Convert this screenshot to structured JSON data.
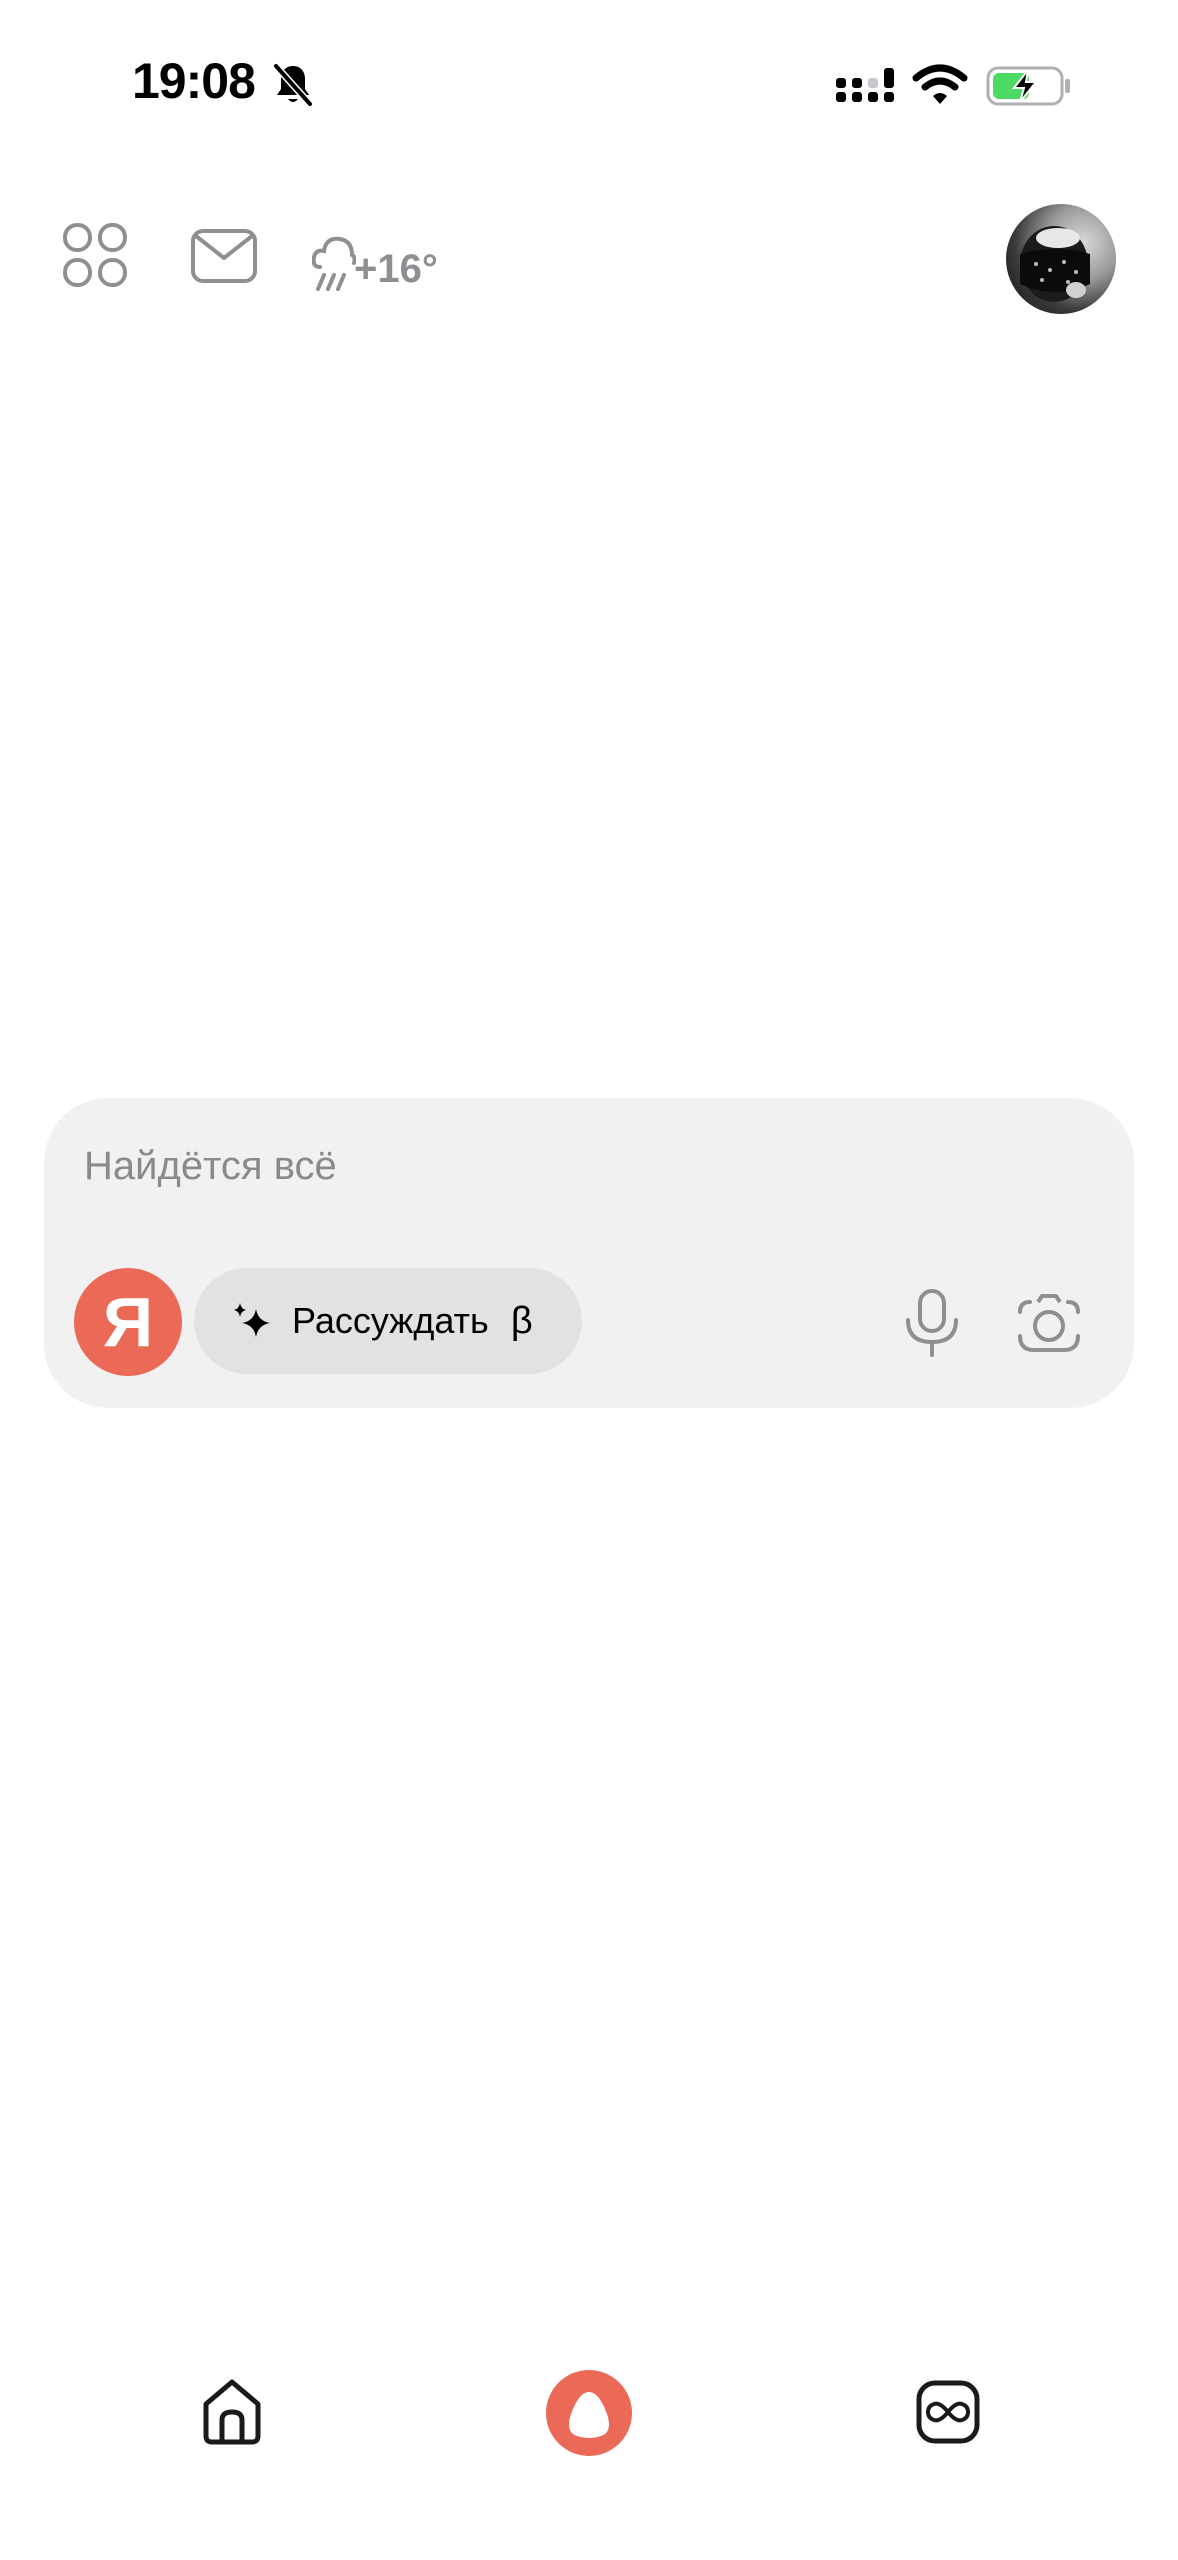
{
  "status_bar": {
    "time": "19:08",
    "icons": [
      "bell-off-icon",
      "cellular-signal-icon",
      "wifi-icon",
      "battery-charging-icon"
    ]
  },
  "top_bar": {
    "services_icon": "grid-icon",
    "mail_icon": "mail-icon",
    "weather": {
      "icon": "rain-cloud-icon",
      "temperature": "+16°"
    },
    "avatar": "user-avatar"
  },
  "search": {
    "placeholder": "Найдётся всё",
    "value": "",
    "yandex_button_label": "Я",
    "reasoning_chip": {
      "icon": "sparkle-icon",
      "label": "Рассуждать",
      "badge": "β"
    },
    "mic_icon": "microphone-icon",
    "camera_icon": "camera-icon"
  },
  "bottom_nav": {
    "items": [
      "home-icon",
      "alice-icon",
      "infinity-icon"
    ]
  },
  "colors": {
    "accent": "#ea6a57",
    "card_background": "#f1f1f1",
    "chip_background": "#e2e2e2",
    "icon_gray": "#8e8e93",
    "battery_green": "#4cd964"
  }
}
